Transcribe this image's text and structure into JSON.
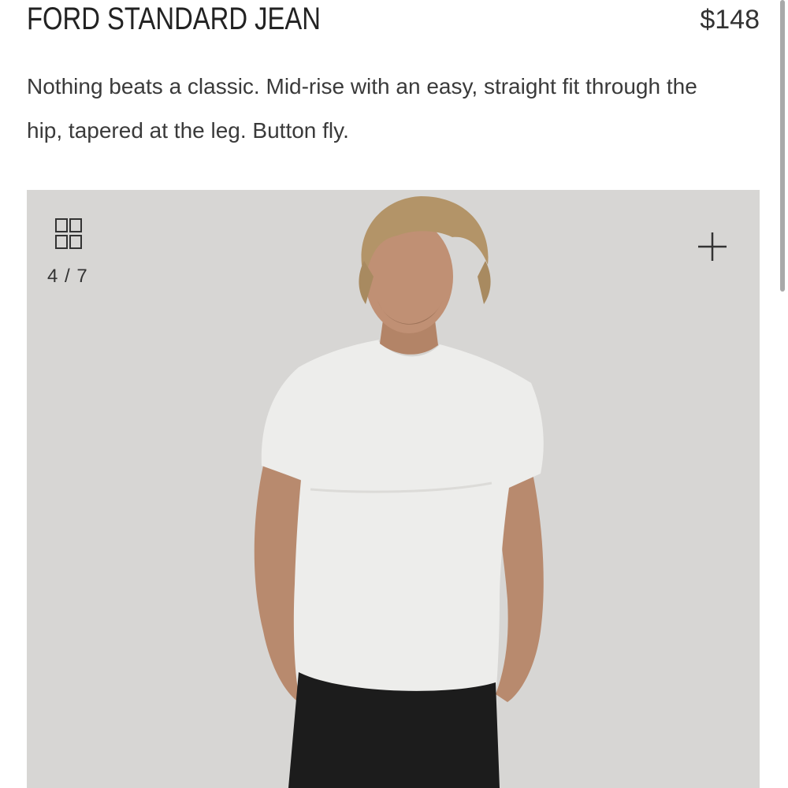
{
  "product": {
    "title": "FORD STANDARD JEAN",
    "price": "$148",
    "description": "Nothing beats a classic. Mid-rise with an easy, straight fit through the hip, tapered at the leg. Button fly."
  },
  "gallery": {
    "counter": "4 / 7",
    "grid_icon": "grid-view-icon",
    "zoom_icon": "plus-icon",
    "image_subject": "model-photo"
  },
  "colors": {
    "background": "#ffffff",
    "gallery_bg": "#d7d6d4",
    "text": "#2b2b2b"
  }
}
